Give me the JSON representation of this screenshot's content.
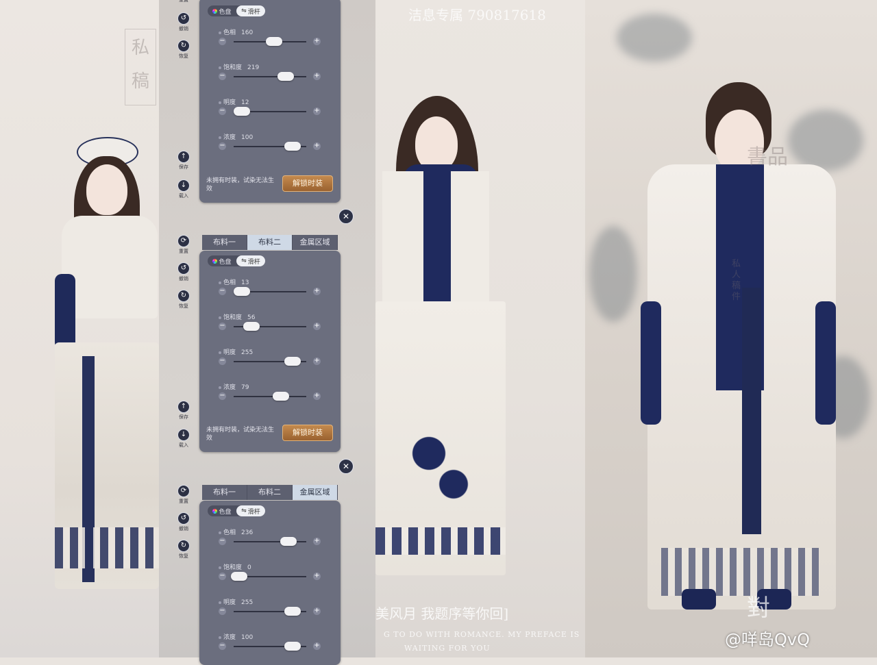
{
  "watermarks": {
    "top_center": "洁息专属  790817618",
    "left_seal_chars": [
      "私",
      "稿"
    ],
    "bottom_center_cn": "美风月 我题序等你回]",
    "bottom_center_en_1": "G TO DO WITH ROMANCE. MY PREFACE IS",
    "bottom_center_en_2": "WAITING FOR YOU",
    "right_vertical": "私人稿件",
    "right_top": "書品",
    "right_bottom": "對"
  },
  "weibo_handle": "@咩岛QvQ",
  "side_buttons": {
    "reset": "重置",
    "undo": "撤销",
    "restore": "恢复",
    "save": "保存",
    "load": "载入"
  },
  "panels": [
    {
      "tabs": [],
      "mode": {
        "palette": "色盘",
        "slider": "滑杆"
      },
      "sliders": [
        {
          "label": "色相",
          "value": "160",
          "level": 0.61
        },
        {
          "label": "饱和度",
          "value": "219",
          "level": 0.81
        },
        {
          "label": "明度",
          "value": "12",
          "level": 0.05
        },
        {
          "label": "浓度",
          "value": "100",
          "level": 0.93
        }
      ],
      "notice": "未拥有时装，试染无法生效",
      "unlock_button": "解锁时装"
    },
    {
      "tabs": [
        {
          "label": "布料一",
          "active": false
        },
        {
          "label": "布料二",
          "active": true
        },
        {
          "label": "金属区域",
          "active": false
        }
      ],
      "mode": {
        "palette": "色盘",
        "slider": "滑杆"
      },
      "sliders": [
        {
          "label": "色相",
          "value": "13",
          "level": 0.05
        },
        {
          "label": "饱和度",
          "value": "56",
          "level": 0.22
        },
        {
          "label": "明度",
          "value": "255",
          "level": 0.93
        },
        {
          "label": "浓度",
          "value": "79",
          "level": 0.73
        }
      ],
      "notice": "未拥有时装，试染无法生效",
      "unlock_button": "解锁时装"
    },
    {
      "tabs": [
        {
          "label": "布料一",
          "active": false
        },
        {
          "label": "布料二",
          "active": false
        },
        {
          "label": "金属区域",
          "active": true
        }
      ],
      "mode": {
        "palette": "色盘",
        "slider": "滑杆"
      },
      "sliders": [
        {
          "label": "色相",
          "value": "236",
          "level": 0.86
        },
        {
          "label": "饱和度",
          "value": "0",
          "level": 0.0
        },
        {
          "label": "明度",
          "value": "255",
          "level": 0.93
        },
        {
          "label": "浓度",
          "value": "100",
          "level": 0.93
        }
      ]
    }
  ],
  "icons": {
    "reset": "refresh-icon",
    "undo": "undo-icon",
    "restore": "redo-icon",
    "save": "upload-icon",
    "load": "download-icon",
    "close": "close-icon"
  }
}
